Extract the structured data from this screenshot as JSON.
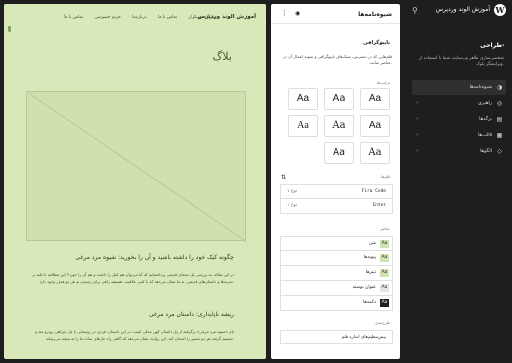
{
  "admin": {
    "site_title": "آموزش الوند وردپرس",
    "section_title": "طراحی",
    "description": "شخصی‌سازی ظاهر وب‌سایت شما با استفاده از ویرایشگر بلوک.",
    "menu": [
      {
        "label": "شیوه‌نامه‌ها",
        "icon": "half-circle-icon",
        "active": true
      },
      {
        "label": "راهبری",
        "icon": "navigation-icon",
        "active": false
      },
      {
        "label": "برگه‌ها",
        "icon": "page-icon",
        "active": false
      },
      {
        "label": "قالب‌ها",
        "icon": "layout-icon",
        "active": false
      },
      {
        "label": "الگوها",
        "icon": "symbol-icon",
        "active": false
      }
    ]
  },
  "panel": {
    "title": "شیوه‌نامه‌ها",
    "subtitle": "تایپوگرافی",
    "description": "قلم‌هایی که در دسترس، سبک‌های تایپوگرافی و نمونه اعمال آن در عناصر سایت.",
    "presets_label": "ترکیب‌ها",
    "preset_sample": "Aa",
    "fonts_label": "قلم‌ها",
    "fonts": [
      {
        "name": "Fira Code",
        "count": "۱ نوع"
      },
      {
        "name": "Inter",
        "count": "۱ نوع"
      }
    ],
    "elements_label": "عناصر",
    "elements": [
      {
        "label": "متن",
        "swatch": "green"
      },
      {
        "label": "پیوندها",
        "swatch": "green"
      },
      {
        "label": "تیترها",
        "swatch": "green"
      },
      {
        "label": "عنوان نوشته",
        "swatch": "light"
      },
      {
        "label": "دکمه‌ها",
        "swatch": "dark"
      }
    ],
    "layout_label": "طرح‌بندی",
    "layout_value": "پیش‌تنظیم‌های اندازه قلم"
  },
  "preview": {
    "site_title": "آموزش الوند وردپرس",
    "nav": [
      "سوالات پرتکرار",
      "تماس با ما",
      "درباره‌ما",
      "حریم خصوصی",
      "تماس با ما"
    ],
    "blog_heading": "بلاگ",
    "heading_a": "چگونه کیک خود را داشته باشید و آن را بخورید: شیوه مرد مرغی",
    "para_a": "در این مقاله، به بررسی یک معمای قدیمی پرداخته‌ایم که آیا می‌توان هم کیک را داشت و هم آن را خورد؟ این مطالعه با تکیه بر تجربه‌ها و داستان‌های قدیمی، به ما نشان می‌دهد که با کمی خلاقیت، همیشه راهی برای رسیدن به هر دو هدف وجود دارد.",
    "heading_b": "ریشه ناپایداری: داستان مرد مرغی",
    "para_b": "نام «شیوه مرد مرغی» برگرفته از یک داستان کهن محلی است. در این داستان، فردی در روستایی با یک دوراهی روبرو شد و تصمیم گرفت هر دو مسیر را امتحان کند. این روایت نشان می‌دهد که گاهی راه حل‌های ساده ما را به نتیجه می‌رساند."
  }
}
